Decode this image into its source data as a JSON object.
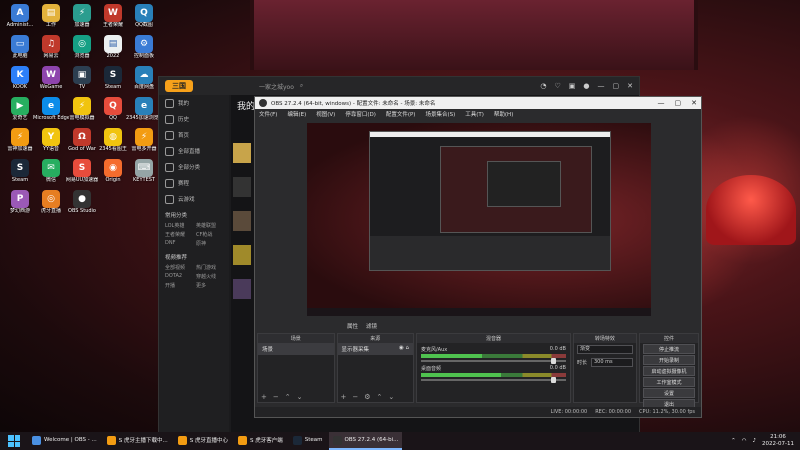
{
  "desktop": {
    "icons": [
      {
        "label": "Administ...",
        "color": "#3a7bd5",
        "glyph": "A"
      },
      {
        "label": "工作",
        "color": "#e3b23c",
        "glyph": "▤"
      },
      {
        "label": "加速器",
        "color": "#2a9d8f",
        "glyph": "⚡"
      },
      {
        "label": "王者荣耀",
        "color": "#c0392b",
        "glyph": "W"
      },
      {
        "label": "QQ截图",
        "color": "#2980b9",
        "glyph": "Q"
      },
      {
        "label": "此电脑",
        "color": "#3a7bd5",
        "glyph": "▭"
      },
      {
        "label": "网易云",
        "color": "#c0392b",
        "glyph": "♫"
      },
      {
        "label": "浏览器",
        "color": "#16a085",
        "glyph": "◎"
      },
      {
        "label": "2022",
        "color": "#ecf0f1",
        "glyph": "▤"
      },
      {
        "label": "控制面板",
        "color": "#3a7bd5",
        "glyph": "⚙"
      },
      {
        "label": "KOOK",
        "color": "#2d7ff9",
        "glyph": "K"
      },
      {
        "label": "WeGame",
        "color": "#8e44ad",
        "glyph": "W"
      },
      {
        "label": "TV",
        "color": "#2c3e50",
        "glyph": "▣"
      },
      {
        "label": "Steam",
        "color": "#1b2838",
        "glyph": "S"
      },
      {
        "label": "百度网盘",
        "color": "#2980b9",
        "glyph": "☁"
      },
      {
        "label": "爱奇艺",
        "color": "#27ae60",
        "glyph": "▶"
      },
      {
        "label": "Microsoft Edge",
        "color": "#0c8ce9",
        "glyph": "e"
      },
      {
        "label": "雷电模拟器",
        "color": "#f1c40f",
        "glyph": "⚡"
      },
      {
        "label": "QQ",
        "color": "#e74c3c",
        "glyph": "Q"
      },
      {
        "label": "2345加速浏览器",
        "color": "#2980b9",
        "glyph": "e"
      },
      {
        "label": "雷神加速器",
        "color": "#f39c12",
        "glyph": "⚡"
      },
      {
        "label": "YY语音",
        "color": "#f1c40f",
        "glyph": "Y"
      },
      {
        "label": "God of War",
        "color": "#c0392b",
        "glyph": "Ω"
      },
      {
        "label": "2345看图王",
        "color": "#f1c40f",
        "glyph": "◍"
      },
      {
        "label": "雷电多开器",
        "color": "#f39c12",
        "glyph": "⚡"
      },
      {
        "label": "Steam",
        "color": "#1b2838",
        "glyph": "S"
      },
      {
        "label": "微信",
        "color": "#27ae60",
        "glyph": "✉"
      },
      {
        "label": "网易UU加速器",
        "color": "#e74c3c",
        "glyph": "S"
      },
      {
        "label": "Origin",
        "color": "#f56c2d",
        "glyph": "◉"
      },
      {
        "label": "KEYTEST",
        "color": "#95a5a6",
        "glyph": "⌨"
      },
      {
        "label": "梦幻西游",
        "color": "#9b59b6",
        "glyph": "P"
      },
      {
        "label": "虎牙直播",
        "color": "#e67e22",
        "glyph": "◎"
      },
      {
        "label": "OBS Studio",
        "color": "#333333",
        "glyph": "●"
      }
    ]
  },
  "huya": {
    "logo": "三国",
    "search_placeholder": "一家之城yoo",
    "sidebar": [
      {
        "label": "我的"
      },
      {
        "label": "历史"
      },
      {
        "label": "首页"
      },
      {
        "label": "全部直播"
      },
      {
        "label": "全部分类"
      },
      {
        "label": "赛程"
      },
      {
        "label": "云游戏"
      }
    ],
    "section_common": "常用分类",
    "common_items": [
      "LOL英雄",
      "英雄联盟",
      "王者荣耀",
      "CF枪战",
      "DNF",
      "原神"
    ],
    "section_hot": "视频推荐",
    "hot_items": [
      "全部视频",
      "热门游戏",
      "DOTA2",
      "穿越火线",
      "开播",
      "更多"
    ],
    "main_title": "我的"
  },
  "obs": {
    "title": "OBS 27.2.4 (64-bit, windows) - 配置文件: 未命名 - 场景: 未命名",
    "menu": [
      "文件(F)",
      "编辑(E)",
      "视图(V)",
      "停靠窗口(D)",
      "配置文件(P)",
      "场景集合(S)",
      "工具(T)",
      "帮助(H)"
    ],
    "scene_tabs": [
      "属性",
      "滤镜"
    ],
    "docks": {
      "scenes_title": "场景",
      "scenes": [
        "场景"
      ],
      "sources_title": "来源",
      "sources": [
        "显示器采集"
      ],
      "mixer_title": "混音器",
      "mixer": [
        {
          "name": "麦克风/Aux",
          "db": "0.0 dB",
          "level": 0.42
        },
        {
          "name": "桌面音频",
          "db": "0.0 dB",
          "level": 0.55
        }
      ],
      "transitions_title": "转场特效",
      "transition_type": "渐变",
      "duration_label": "时长",
      "duration_value": "300 ms",
      "controls_title": "控件",
      "controls": [
        "停止推流",
        "开始录制",
        "启动虚拟摄像机",
        "工作室模式",
        "设置",
        "退出"
      ]
    },
    "status": {
      "live": "LIVE: 00:00:00",
      "rec": "REC: 00:00:00",
      "cpu": "CPU: 11.2%, 30.00 fps"
    }
  },
  "taskbar": {
    "items": [
      {
        "label": "Welcome | OBS - ...",
        "color": "#4a90e2",
        "active": false
      },
      {
        "label": "S 虎牙主播下载中...",
        "color": "#f39c12",
        "active": false
      },
      {
        "label": "S 虎牙直播中心",
        "color": "#f39c12",
        "active": false
      },
      {
        "label": "S 虎牙客户端",
        "color": "#f39c12",
        "active": false
      },
      {
        "label": "Steam",
        "color": "#1b2838",
        "active": false
      },
      {
        "label": "OBS 27.2.4 (64-bi...",
        "color": "#333333",
        "active": true
      }
    ],
    "time": "21:06",
    "date": "2022-07-11"
  }
}
